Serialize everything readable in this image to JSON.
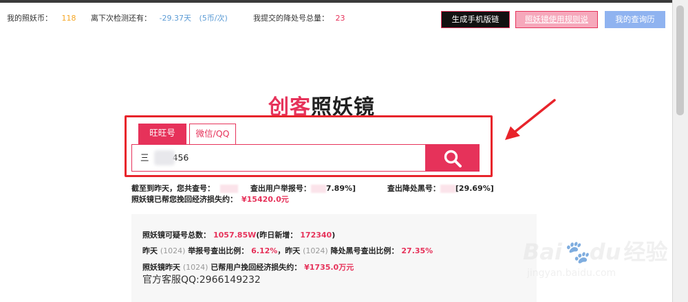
{
  "header": {
    "coins_label": "我的照妖币：",
    "coins_value": "118",
    "next_check_label": "离下次检测还有：",
    "next_check_days": "-29.37天",
    "next_check_cost": "(5币/次)",
    "submitted_label": "我提交的降处号总量：",
    "submitted_value": "23",
    "buttons": {
      "mobile_link": "生成手机版链接",
      "rules": "照妖镜使用规则说明",
      "history": "我的查询历史"
    }
  },
  "logo": {
    "part1": "创客",
    "part2": "照妖镜"
  },
  "search": {
    "tabs": [
      {
        "label": "旺旺号",
        "active": true
      },
      {
        "label": "微信/QQ",
        "active": false
      }
    ],
    "input_prefix": "三",
    "input_suffix": "456",
    "button_icon": "search-icon"
  },
  "summary": {
    "line1": {
      "label_a": "截至到昨天，您共查号：",
      "label_b": "查出用户举报号：",
      "value_b": "7.89%]",
      "label_c": "查出降处黑号：",
      "value_c": "[29.69%]"
    },
    "line2": {
      "label": "照妖镜已帮您挽回经济损失约：",
      "value": "¥15420.0元"
    }
  },
  "stats_panel": {
    "line1": {
      "label": "照妖镜可疑号总数：",
      "value": "1057.85W",
      "mid": "(昨日新增：",
      "new_value": "172340",
      "end": ")"
    },
    "line2": {
      "a": "昨天",
      "b": "(1024)",
      "c": "举报号查出比例：",
      "d": "6.12%",
      "e": "，昨天",
      "f": "(1024)",
      "g": "降处黑号查出比例：",
      "h": "27.35%"
    },
    "line3": {
      "a": "照妖镜昨天",
      "b": "(1024)",
      "c": "已帮用户挽回经济损失约：",
      "d": "¥1735.0万元"
    },
    "qq": "官方客服QQ:2966149232"
  },
  "watermark": {
    "brand": "Bai",
    "brand2": "du",
    "cn": "经验",
    "url": "jingyan.baidu.com"
  },
  "colors": {
    "accent": "#e6325a",
    "orange": "#f5a623",
    "blue": "#5b9bd5",
    "annotation": "#e8242b"
  }
}
